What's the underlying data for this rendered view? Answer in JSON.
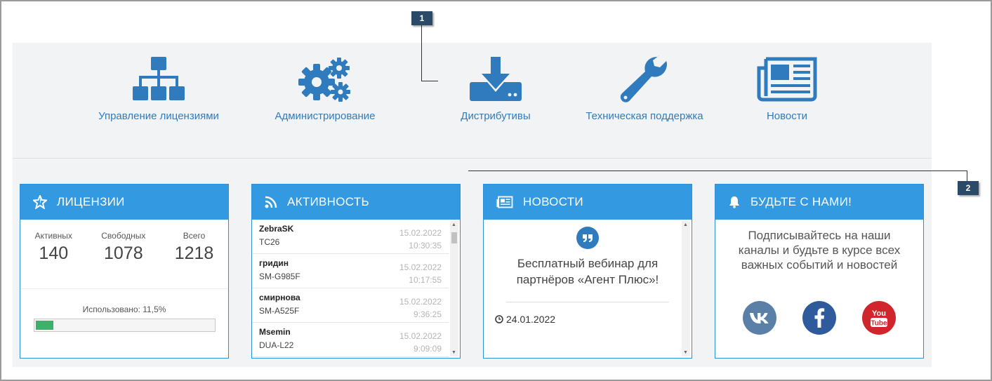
{
  "nav": [
    {
      "label": "Управление лицензиями",
      "icon": "sitemap-icon"
    },
    {
      "label": "Администрирование",
      "icon": "gears-icon"
    },
    {
      "label": "Дистрибутивы",
      "icon": "download-icon"
    },
    {
      "label": "Техническая поддержка",
      "icon": "wrench-icon"
    },
    {
      "label": "Новости",
      "icon": "newspaper-icon"
    }
  ],
  "licenses": {
    "title": "Лицензии",
    "icon": "star-icon",
    "active_label": "Активных",
    "active_value": "140",
    "free_label": "Свободных",
    "free_value": "1078",
    "total_label": "Всего",
    "total_value": "1218",
    "used_text": "Использовано: 11,5%",
    "used_fraction": 0.115
  },
  "activity": {
    "title": "Активность",
    "icon": "rss-icon",
    "rows": [
      {
        "user": "ZebraSK",
        "device": "TC26",
        "date": "15.02.2022",
        "time": "10:30:35"
      },
      {
        "user": "гридин",
        "device": "SM-G985F",
        "date": "15.02.2022",
        "time": "10:17:55"
      },
      {
        "user": "смирнова",
        "device": "SM-A525F",
        "date": "15.02.2022",
        "time": "9:36:25"
      },
      {
        "user": "Msemin",
        "device": "DUA-L22",
        "date": "15.02.2022",
        "time": "9:09:09"
      }
    ]
  },
  "news": {
    "title": "Новости",
    "icon": "newspaper-icon",
    "quote_icon": "quote-icon",
    "headline": "Бесплатный вебинар для партнёров «Агент Плюс»!",
    "date": "24.01.2022",
    "date_icon": "clock-icon"
  },
  "social": {
    "title": "Будьте с нами!",
    "icon": "bell-icon",
    "text": "Подписывайтесь на наши каналы и будьте в курсе всех важных событий и новостей",
    "links": [
      {
        "name": "vk",
        "icon": "vk-icon",
        "color": "#5a80a8"
      },
      {
        "name": "facebook",
        "icon": "facebook-icon",
        "color": "#2f5b9d"
      },
      {
        "name": "youtube",
        "icon": "youtube-icon",
        "color": "#d0252b",
        "label": "You Tube"
      }
    ]
  },
  "callouts": [
    "1",
    "2"
  ],
  "colors": {
    "accent": "#3399e0",
    "nav_text": "#2f7bbd",
    "progress": "#3fb06a",
    "callout": "#2a4a68"
  }
}
